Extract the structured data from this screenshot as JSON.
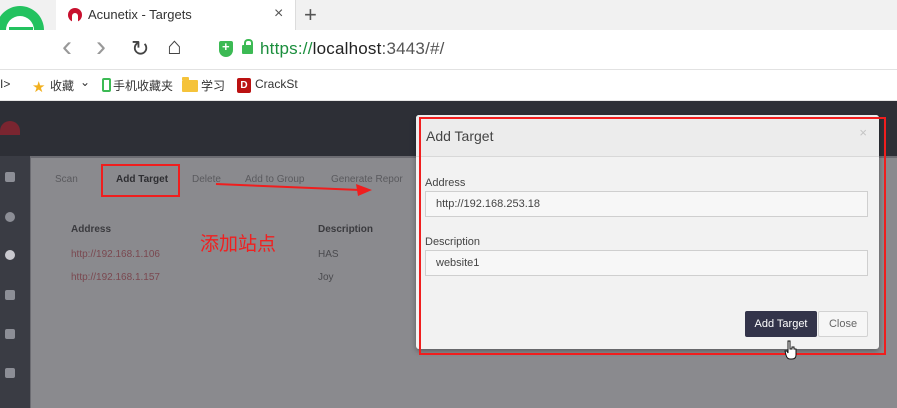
{
  "browser": {
    "tab_title": "Acunetix - Targets",
    "tab_close": "×",
    "new_tab": "+",
    "url_https": "https://",
    "url_host": "localhost",
    "url_rest": ":3443/#/",
    "nav_back": "‹",
    "nav_forward": "›",
    "nav_reload": "↻",
    "nav_home": "⌂",
    "bookmarks": {
      "toggle": "I>",
      "favorites": "收藏",
      "favorites_caret": "⌄",
      "mobile": "手机收藏夹",
      "study": "学习",
      "crack_icon": "D",
      "crack": "CrackSt"
    }
  },
  "toolbar": {
    "scan": "Scan",
    "add_target": "Add Target",
    "delete": "Delete",
    "add_to_group": "Add to Group",
    "generate_report": "Generate Repor"
  },
  "table": {
    "headers": {
      "address": "Address",
      "description": "Description"
    },
    "rows": [
      {
        "address": "http://192.168.1.106",
        "description": "HAS"
      },
      {
        "address": "http://192.168.1.157",
        "description": "Joy"
      }
    ]
  },
  "annotation": {
    "text": "添加站点",
    "color": "#f01e1e"
  },
  "modal": {
    "title": "Add Target",
    "close_x": "×",
    "address_label": "Address",
    "address_value": "http://192.168.253.18",
    "description_label": "Description",
    "description_value": "website1",
    "add_button": "Add Target",
    "close_button": "Close"
  },
  "colors": {
    "primary_button": "#33344a",
    "secure_green": "#1b8e3d",
    "app_header": "#2d2f36"
  }
}
